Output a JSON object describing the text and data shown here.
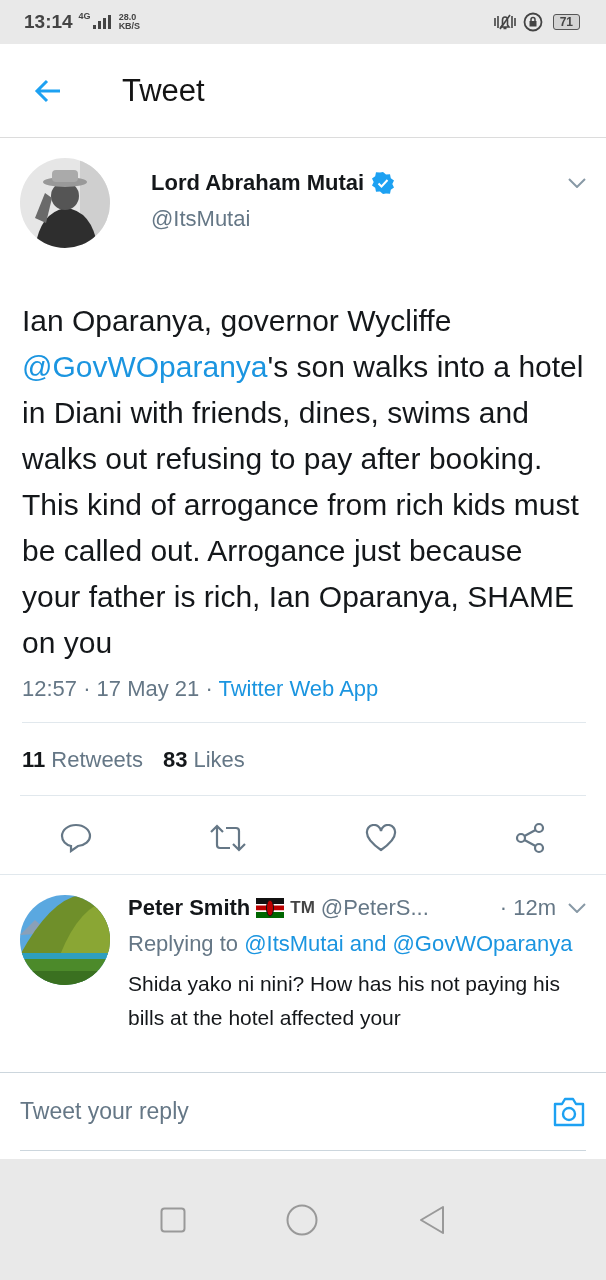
{
  "status_bar": {
    "time": "13:14",
    "network": "4G",
    "speed": "28.0",
    "speed_unit": "KB/S",
    "battery": "71"
  },
  "header": {
    "title": "Tweet"
  },
  "tweet": {
    "author": "Lord Abraham Mutai",
    "verified": true,
    "handle": "@ItsMutai",
    "text": [
      {
        "kind": "text",
        "text": "Ian Oparanya, governor Wycliffe "
      },
      {
        "kind": "mention",
        "text": "@GovWOparanya"
      },
      {
        "kind": "text",
        "text": "'s son walks into a hotel in Diani with friends, dines, swims and walks out refusing to pay after booking. This kind of arrogance from rich kids must be called out. Arrogance just because your father is rich, Ian Oparanya, SHAME on you"
      }
    ],
    "time": "12:57 · 17 May 21 · ",
    "source": "Twitter Web App",
    "stats": [
      {
        "count": "11",
        "label": "Retweets"
      },
      {
        "count": "83",
        "label": "Likes"
      }
    ]
  },
  "reply": {
    "author": "Peter Smith",
    "badge": "TM",
    "handle": "@PeterS...",
    "age": "· 12m",
    "replying_to": [
      {
        "kind": "text",
        "text": "Replying to "
      },
      {
        "kind": "mention",
        "text": "@ItsMutai and @GovWOparanya"
      }
    ],
    "text": "Shida yako ni nini? How has his not paying his bills at the hotel affected your"
  },
  "composer": {
    "placeholder": "Tweet your reply"
  }
}
